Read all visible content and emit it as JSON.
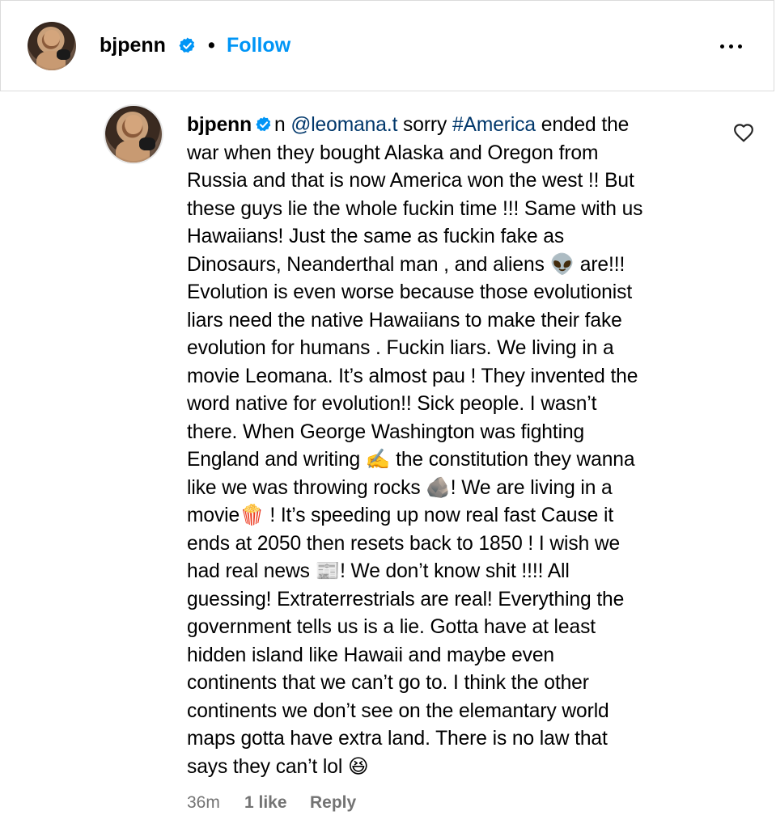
{
  "header": {
    "username": "bjpenn",
    "separator": "•",
    "follow_label": "Follow",
    "more_icon": "more-horizontal-icon",
    "verified_icon": "verified-badge-icon"
  },
  "comment": {
    "username": "bjpenn",
    "prefix": "n ",
    "mention": "@leomana.t",
    "text_before_hashtag": " sorry ",
    "hashtag": "#America",
    "lines": [
      " ended the",
      "war when they bought Alaska and Oregon from",
      "Russia and that is now America won the west !! But",
      "these guys lie the whole fuckin time !!! Same with us",
      "Hawaiians! Just the same as fuckin fake as",
      "Dinosaurs, Neanderthal man , and aliens 👽 are!!!",
      "Evolution is even worse because those evolutionist",
      "liars need the native Hawaiians to make their fake",
      "evolution for humans . Fuckin liars. We living in a",
      "movie Leomana. It’s almost pau ! They invented the",
      "word native for evolution!! Sick people. I wasn’t",
      "there. When George Washington was fighting",
      "England and writing ✍️ the constitution they wanna",
      "like we was throwing rocks 🪨! We are living in a",
      "movie🍿 ! It’s speeding up now real fast Cause it",
      "ends at 2050 then resets back to 1850 ! I wish we",
      "had real news 📰! We don’t know shit !!!! All",
      "guessing! Extraterrestrials are real! Everything the",
      "government tells us is a lie. Gotta have at least",
      "hidden island like Hawaii and maybe even",
      "continents that we can’t go to. I think the other",
      "continents we don’t see on the elemantary world",
      "maps gotta have extra land. There is no law that",
      "says they can’t lol 😆"
    ],
    "like_icon": "heart-outline-icon",
    "time": "36m",
    "likes": "1 like",
    "reply_label": "Reply"
  },
  "colors": {
    "link_blue": "#0095f6",
    "mention_blue": "#00376b",
    "meta_gray": "#737373",
    "border": "#dbdbdb",
    "verified_blue": "#0095f6"
  }
}
